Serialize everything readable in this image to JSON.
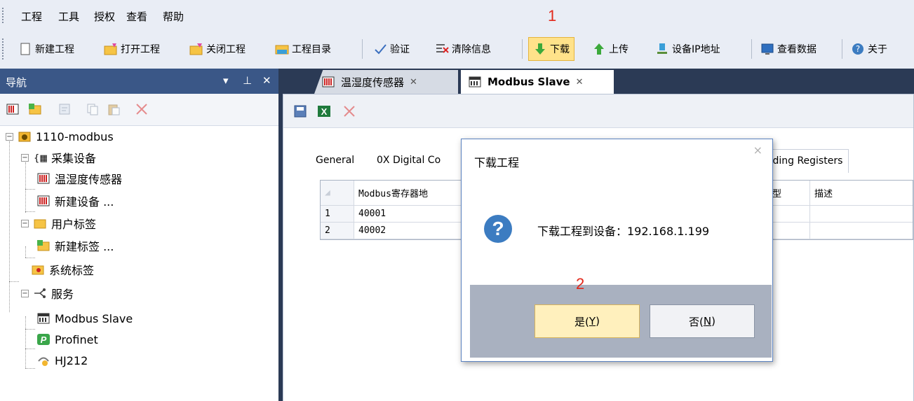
{
  "menu": {
    "items": [
      "工程",
      "工具",
      "授权",
      "查看",
      "帮助"
    ]
  },
  "annotations": {
    "step1": "1",
    "step2": "2"
  },
  "toolbar": {
    "new_project": "新建工程",
    "open_project": "打开工程",
    "close_project": "关闭工程",
    "project_dir": "工程目录",
    "verify": "验证",
    "clear_info": "清除信息",
    "download": "下载",
    "upload": "上传",
    "device_ip": "设备IP地址",
    "view_data": "查看数据",
    "about": "关于"
  },
  "nav": {
    "title": "导航",
    "pin": "ᅟ",
    "tree": {
      "root": "1110-modbus",
      "collect_devices": "采集设备",
      "device1": "温湿度传感器",
      "new_device": "新建设备 ...",
      "user_tags": "用户标签",
      "new_tag": "新建标签 ...",
      "system_tags": "系统标签",
      "services": "服务",
      "modbus_slave": "Modbus Slave",
      "profinet": "Profinet",
      "hj212": "HJ212"
    }
  },
  "doc_tabs": {
    "tab1": "温湿度传感器",
    "tab2": "Modbus Slave"
  },
  "subtabs": {
    "general": "General",
    "digital_coils": "0X Digital Co",
    "holding_registers": "olding Registers"
  },
  "grid": {
    "headers": {
      "address": "Modbus寄存器地",
      "type": "型",
      "desc": "描述"
    },
    "rows": [
      {
        "num": "1",
        "address": "40001"
      },
      {
        "num": "2",
        "address": "40002"
      }
    ]
  },
  "dialog": {
    "title": "下载工程",
    "close": "×",
    "icon": "?",
    "message": "下载工程到设备：192.168.1.199",
    "yes_label": "是(",
    "yes_key": "Y",
    "no_label": "否(",
    "no_key": "N",
    "close_paren": ")"
  },
  "colors": {
    "accent": "#3a5787",
    "highlight": "#ffe28a",
    "annotation": "#e2281b"
  }
}
